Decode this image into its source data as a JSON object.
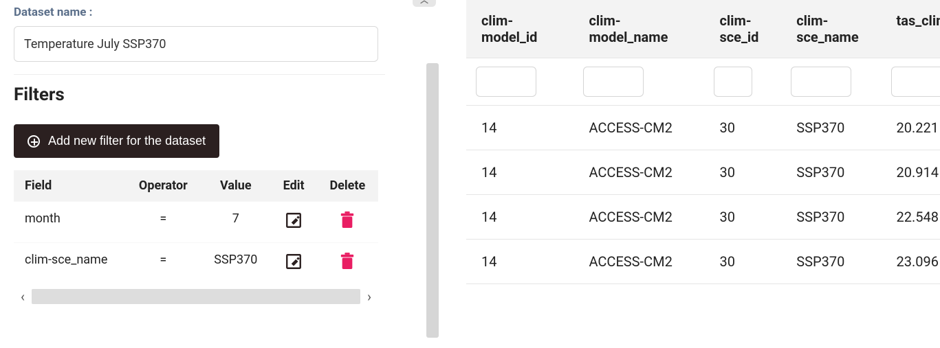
{
  "left": {
    "dataset_label": "Dataset name :",
    "dataset_name": "Temperature July SSP370",
    "filters_heading": "Filters",
    "add_filter_label": "Add new filter for the dataset",
    "filters_table": {
      "headers": {
        "field": "Field",
        "operator": "Operator",
        "value": "Value",
        "edit": "Edit",
        "delete": "Delete"
      },
      "rows": [
        {
          "field": "month",
          "operator": "=",
          "value": "7"
        },
        {
          "field": "clim-sce_name",
          "operator": "=",
          "value": "SSP370"
        }
      ]
    }
  },
  "right": {
    "columns": [
      {
        "key": "clim_model_id",
        "header": "clim-model_id"
      },
      {
        "key": "clim_model_name",
        "header": "clim-model_name"
      },
      {
        "key": "clim_sce_id",
        "header": "clim-sce_id"
      },
      {
        "key": "clim_sce_name",
        "header": "clim-sce_name"
      },
      {
        "key": "tas_climate",
        "header": "tas_climate"
      }
    ],
    "rows": [
      {
        "clim_model_id": "14",
        "clim_model_name": "ACCESS-CM2",
        "clim_sce_id": "30",
        "clim_sce_name": "SSP370",
        "tas_climate": "20.221"
      },
      {
        "clim_model_id": "14",
        "clim_model_name": "ACCESS-CM2",
        "clim_sce_id": "30",
        "clim_sce_name": "SSP370",
        "tas_climate": "20.914"
      },
      {
        "clim_model_id": "14",
        "clim_model_name": "ACCESS-CM2",
        "clim_sce_id": "30",
        "clim_sce_name": "SSP370",
        "tas_climate": "22.548"
      },
      {
        "clim_model_id": "14",
        "clim_model_name": "ACCESS-CM2",
        "clim_sce_id": "30",
        "clim_sce_name": "SSP370",
        "tas_climate": "23.096"
      }
    ]
  },
  "colors": {
    "accent_pink": "#e91e63",
    "dark_btn": "#2b2020"
  }
}
